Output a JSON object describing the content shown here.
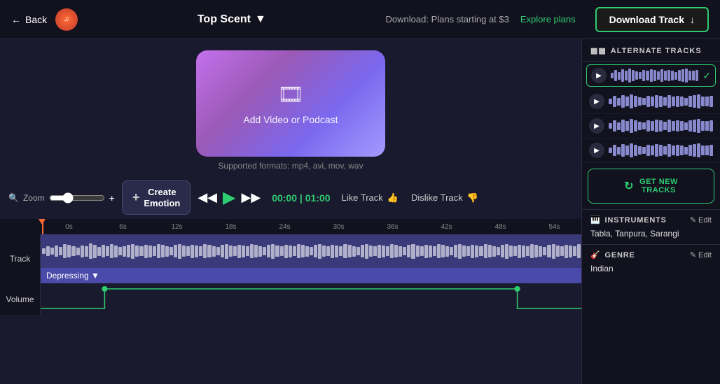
{
  "header": {
    "back_label": "Back",
    "top_scent_label": "Top Scent",
    "download_info": "Download: Plans starting at $3",
    "explore_plans_label": "Explore plans",
    "download_track_label": "Download Track"
  },
  "video": {
    "add_label": "Add Video or Podcast",
    "supported_formats": "Supported formats: mp4, avi, mov, wav"
  },
  "controls": {
    "zoom_label": "Zoom",
    "create_emotion_label": "Create\nEmotion",
    "time_current": "00:00",
    "time_total": "01:00",
    "like_track_label": "Like Track",
    "dislike_track_label": "Dislike Track"
  },
  "timeline": {
    "ruler_marks": [
      "6s",
      "12s",
      "18s",
      "24s",
      "30s",
      "36s",
      "42s",
      "48s",
      "54s"
    ],
    "track_label": "Track",
    "emotion_label": "Depressing",
    "volume_label": "Volume"
  },
  "sidebar": {
    "alternate_tracks_header": "ALTERNATE TRACKS",
    "tracks": [
      {
        "id": 1,
        "selected": true
      },
      {
        "id": 2,
        "selected": false
      },
      {
        "id": 3,
        "selected": false
      },
      {
        "id": 4,
        "selected": false
      }
    ],
    "get_new_tracks_label": "GET NEW\nTRACKS",
    "instruments_header": "INSTRUMENTS",
    "instruments_edit_label": "Edit",
    "instruments_value": "Tabla, Tanpura, Sarangi",
    "genre_header": "GENRE",
    "genre_edit_label": "Edit",
    "genre_value": "Indian"
  }
}
